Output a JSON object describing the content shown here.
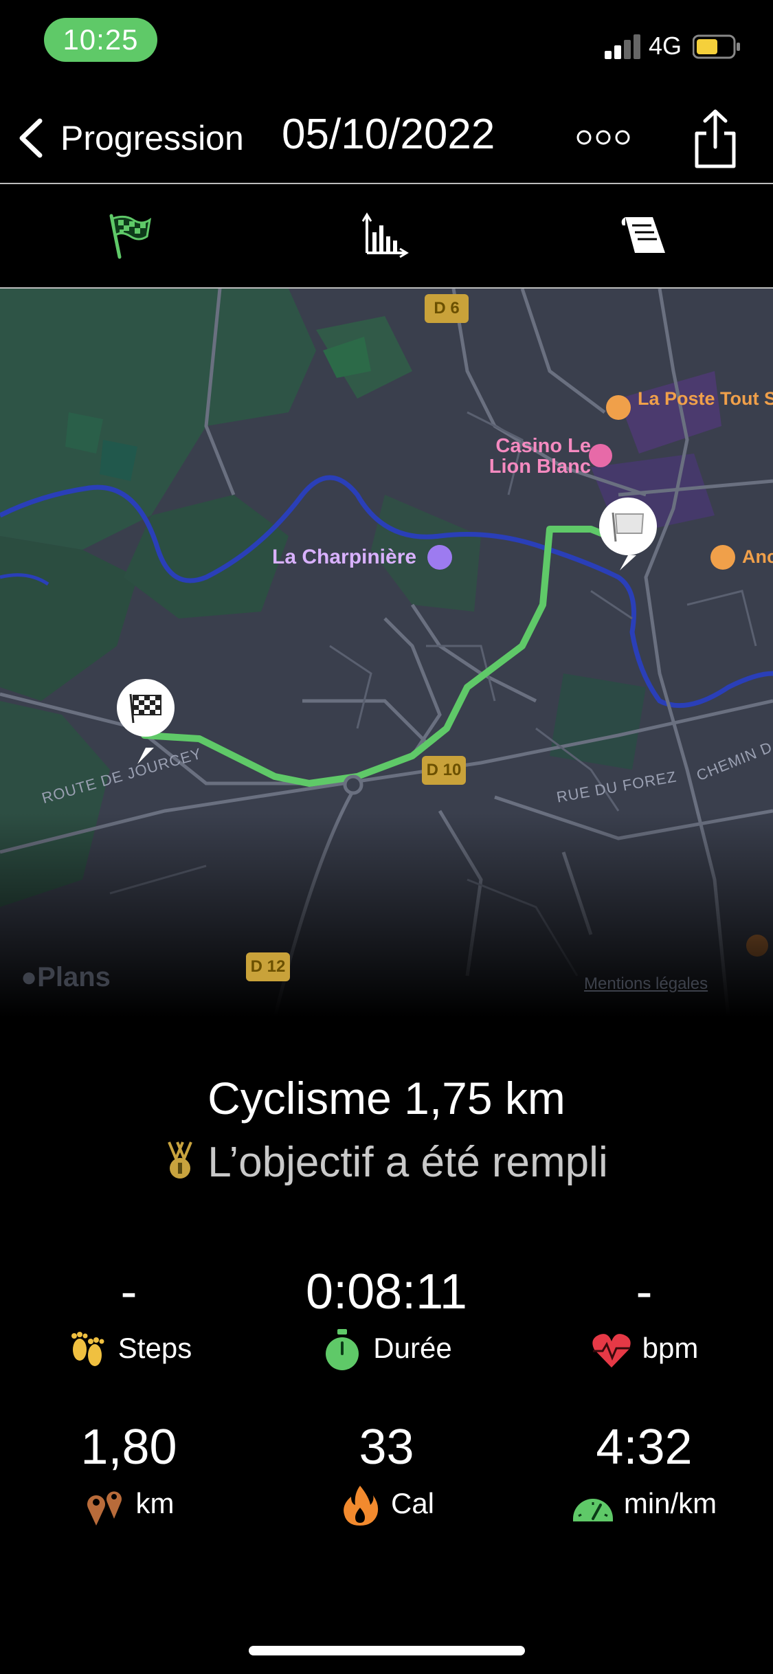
{
  "status_bar": {
    "time": "10:25",
    "network": "4G"
  },
  "nav": {
    "back_label": "Progression",
    "date": "05/10/2022"
  },
  "tabs": [
    {
      "id": "route",
      "icon": "checkered-flag-icon"
    },
    {
      "id": "charts",
      "icon": "bar-chart-icon"
    },
    {
      "id": "notes",
      "icon": "notes-icon"
    }
  ],
  "map": {
    "places": {
      "la_poste": "La Poste Tout Simplement",
      "casino": "Casino Le Lion Blanc",
      "charpiniere": "La Charpinière",
      "partial_right": "Anc"
    },
    "roads": {
      "d6": "D 6",
      "d10": "D 10",
      "d12": "D 12",
      "route_jourcey": "ROUTE DE JOURCEY",
      "rue_forez": "RUE DU FOREZ",
      "chemin": "CHEMIN D"
    },
    "attribution": "Plans",
    "legal": "Mentions légales",
    "colors": {
      "route": "#5fc968",
      "river": "#2a3fb8",
      "background": "#3c4150"
    }
  },
  "summary": {
    "title": "Cyclisme 1,75 km",
    "goal": "L’objectif a été rempli"
  },
  "stats": {
    "steps": {
      "value": "-",
      "label": "Steps",
      "icon": "footprints-icon",
      "color": "#f0c040"
    },
    "duration": {
      "value": "0:08:11",
      "label": "Durée",
      "icon": "stopwatch-icon",
      "color": "#5fc968"
    },
    "heart": {
      "value": "-",
      "label": "bpm",
      "icon": "heart-rate-icon",
      "color": "#e63946"
    },
    "distance": {
      "value": "1,80",
      "label": "km",
      "icon": "location-pins-icon",
      "color": "#b86b3a"
    },
    "calories": {
      "value": "33",
      "label": "Cal",
      "icon": "flame-icon",
      "color": "#f28a2e"
    },
    "pace": {
      "value": "4:32",
      "label": "min/km",
      "icon": "speedometer-icon",
      "color": "#5fc968"
    }
  }
}
